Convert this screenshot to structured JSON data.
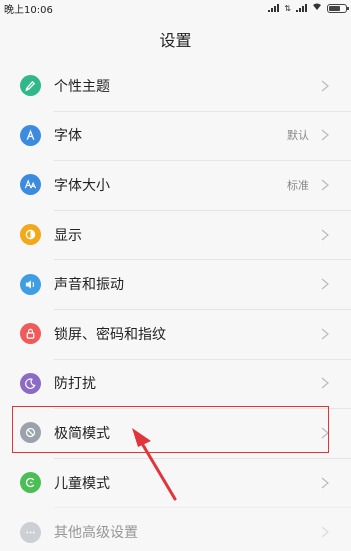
{
  "status_bar": {
    "time": "晚上10:06"
  },
  "header": {
    "title": "设置"
  },
  "colors": {
    "accent_red": "#e0353b"
  },
  "items": [
    {
      "label": "个性主题",
      "value": "",
      "icon": "theme-icon",
      "icon_color": "#2fb98a"
    },
    {
      "label": "字体",
      "value": "默认",
      "icon": "font-icon",
      "icon_color": "#3d8be0"
    },
    {
      "label": "字体大小",
      "value": "标准",
      "icon": "font-size-icon",
      "icon_color": "#3d8be0"
    },
    {
      "label": "显示",
      "value": "",
      "icon": "display-icon",
      "icon_color": "#f2a818"
    },
    {
      "label": "声音和振动",
      "value": "",
      "icon": "sound-icon",
      "icon_color": "#3f9de3"
    },
    {
      "label": "锁屏、密码和指纹",
      "value": "",
      "icon": "lock-icon",
      "icon_color": "#ef5b5b"
    },
    {
      "label": "防打扰",
      "value": "",
      "icon": "moon-icon",
      "icon_color": "#8b6bc3"
    },
    {
      "label": "极简模式",
      "value": "",
      "icon": "minimal-mode-icon",
      "icon_color": "#9aa3ab"
    },
    {
      "label": "儿童模式",
      "value": "",
      "icon": "kids-mode-icon",
      "icon_color": "#4bbf55"
    },
    {
      "label": "其他高级设置",
      "value": "",
      "icon": "more-icon",
      "icon_color": "#9aa3ab"
    }
  ]
}
